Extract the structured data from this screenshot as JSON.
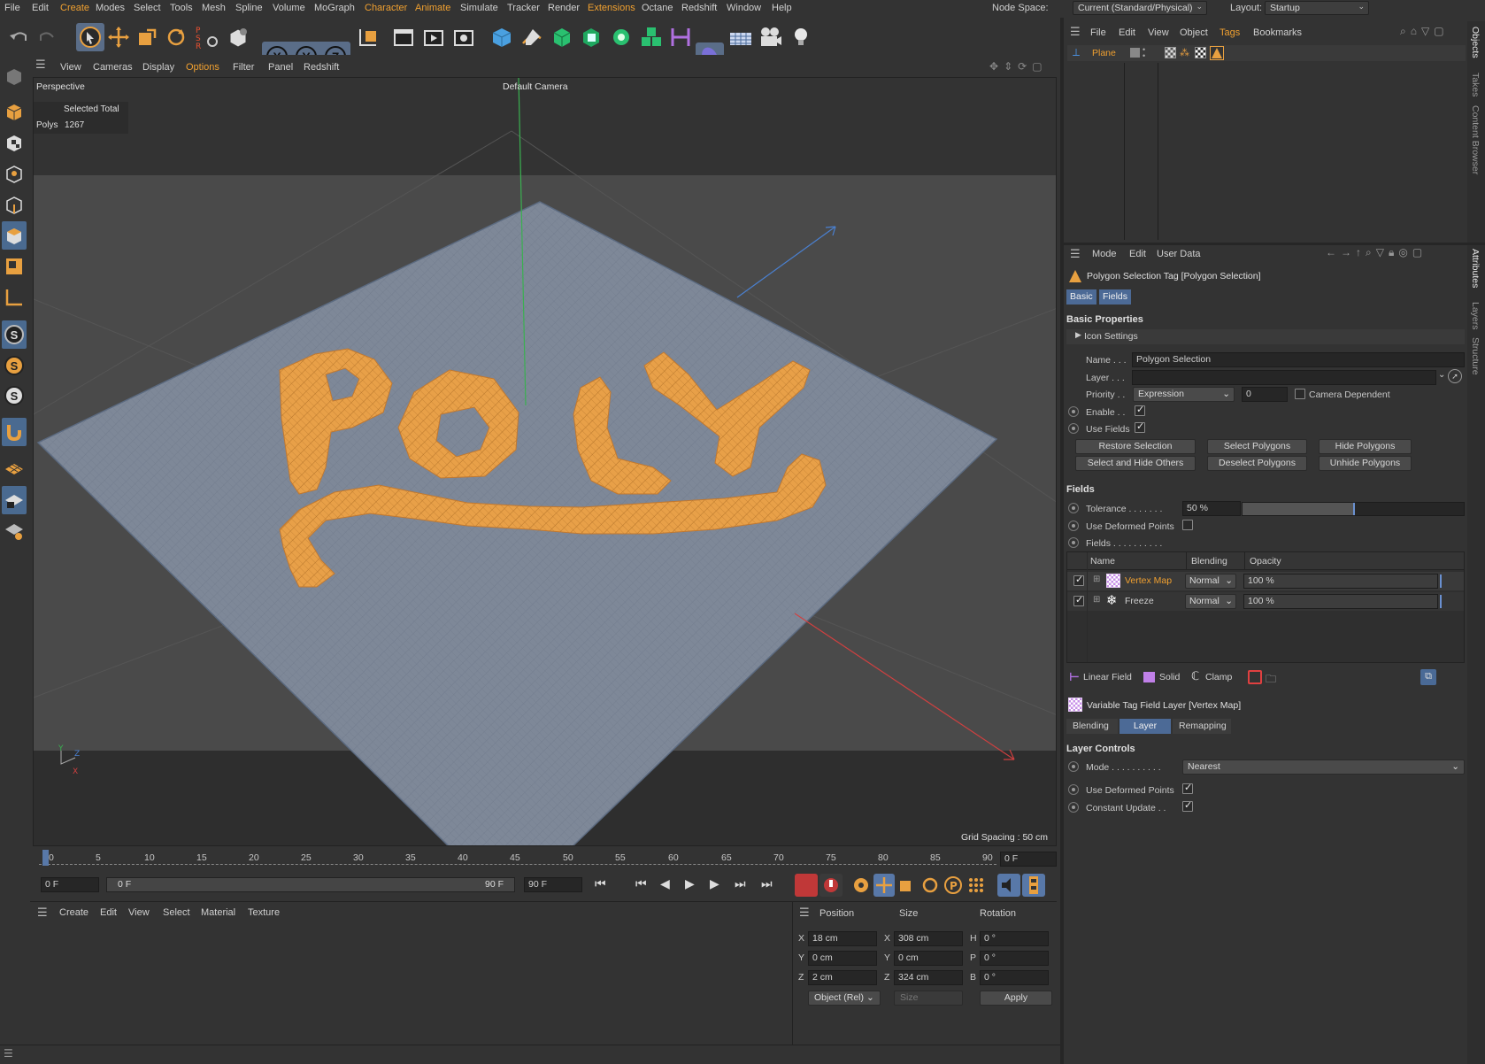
{
  "menubar": {
    "items": [
      "File",
      "Edit",
      "Create",
      "Modes",
      "Select",
      "Tools",
      "Mesh",
      "Spline",
      "Volume",
      "MoGraph",
      "Character",
      "Animate",
      "Simulate",
      "Tracker",
      "Render",
      "Extensions",
      "Octane",
      "Redshift",
      "Window",
      "Help"
    ],
    "node_space_label": "Node Space:",
    "node_space_value": "Current (Standard/Physical)",
    "layout_label": "Layout:",
    "layout_value": "Startup"
  },
  "toolbar": {
    "axis_x": "X",
    "axis_y": "Y",
    "axis_z": "Z"
  },
  "viewport": {
    "menu": [
      "View",
      "Cameras",
      "Display",
      "Options",
      "Filter",
      "Panel",
      "Redshift"
    ],
    "projection": "Perspective",
    "camera": "Default Camera",
    "stats_header": "Selected Total",
    "stats_label": "Polys",
    "stats_value": "1267",
    "grid_spacing": "Grid Spacing : 50 cm",
    "mesh_text": "POLY",
    "colors": {
      "plane": "#7e8898",
      "selection": "#e8a048",
      "background": "#4a4a4a"
    }
  },
  "timeline": {
    "ticks": [
      "0",
      "5",
      "10",
      "15",
      "20",
      "25",
      "30",
      "35",
      "40",
      "45",
      "50",
      "55",
      "60",
      "65",
      "70",
      "75",
      "80",
      "85",
      "90"
    ],
    "current_frame": "0 F",
    "start_frame": "0 F",
    "range_start": "0 F",
    "range_end": "90 F",
    "end_frame": "90 F"
  },
  "materials": {
    "menu": [
      "Create",
      "Edit",
      "View",
      "Select",
      "Material",
      "Texture"
    ]
  },
  "coords": {
    "headers": [
      "Position",
      "Size",
      "Rotation"
    ],
    "rows": [
      {
        "axis": "X",
        "pos": "18 cm",
        "size_axis": "X",
        "size": "308 cm",
        "rot_axis": "H",
        "rot": "0 °"
      },
      {
        "axis": "Y",
        "pos": "0 cm",
        "size_axis": "Y",
        "size": "0 cm",
        "rot_axis": "P",
        "rot": "0 °"
      },
      {
        "axis": "Z",
        "pos": "2 cm",
        "size_axis": "Z",
        "size": "324 cm",
        "rot_axis": "B",
        "rot": "0 °"
      }
    ],
    "mode": "Object (Rel)",
    "size_mode": "Size",
    "apply": "Apply"
  },
  "object_manager": {
    "menu": [
      "File",
      "Edit",
      "View",
      "Object",
      "Tags",
      "Bookmarks"
    ],
    "object_name": "Plane",
    "side_tabs": [
      "Objects",
      "Takes",
      "Content Browser"
    ]
  },
  "attributes": {
    "menu": [
      "Mode",
      "Edit",
      "User Data"
    ],
    "title": "Polygon Selection Tag [Polygon Selection]",
    "tabs": [
      "Basic",
      "Fields"
    ],
    "section_basic": "Basic Properties",
    "icon_settings": "Icon Settings",
    "name_label": "Name . . .",
    "name_value": "Polygon Selection",
    "layer_label": "Layer . . .",
    "priority_label": "Priority . .",
    "priority_value": "Expression",
    "priority_num": "0",
    "camera_dependent": "Camera Dependent",
    "enable_label": "Enable . .",
    "use_fields_label": "Use Fields",
    "buttons": [
      "Restore Selection",
      "Select Polygons",
      "Hide Polygons",
      "Select and Hide Others",
      "Deselect Polygons",
      "Unhide Polygons"
    ],
    "section_fields": "Fields",
    "tolerance_label": "Tolerance . . . . . . .",
    "tolerance_value": "50 %",
    "tolerance_fraction": 0.5,
    "use_deformed_label": "Use Deformed Points",
    "fields_label": "Fields . . . . . . . . . .",
    "fields_table": {
      "headers": [
        "Name",
        "Blending",
        "Opacity"
      ],
      "rows": [
        {
          "name": "Vertex Map",
          "blending": "Normal",
          "opacity": "100 %"
        },
        {
          "name": "Freeze",
          "blending": "Normal",
          "opacity": "100 %"
        }
      ]
    },
    "field_buttons": [
      "Linear Field",
      "Solid",
      "Clamp"
    ],
    "layer_title": "Variable Tag Field Layer [Vertex Map]",
    "layer_tabs": [
      "Blending",
      "Layer",
      "Remapping"
    ],
    "section_layer_controls": "Layer Controls",
    "mode_label": "Mode . . . . . . . . . .",
    "mode_value": "Nearest",
    "use_deformed_label2": "Use Deformed Points",
    "constant_update_label": "Constant Update . ."
  },
  "side_tabs_right": [
    "Attributes",
    "Layers",
    "Structure"
  ]
}
